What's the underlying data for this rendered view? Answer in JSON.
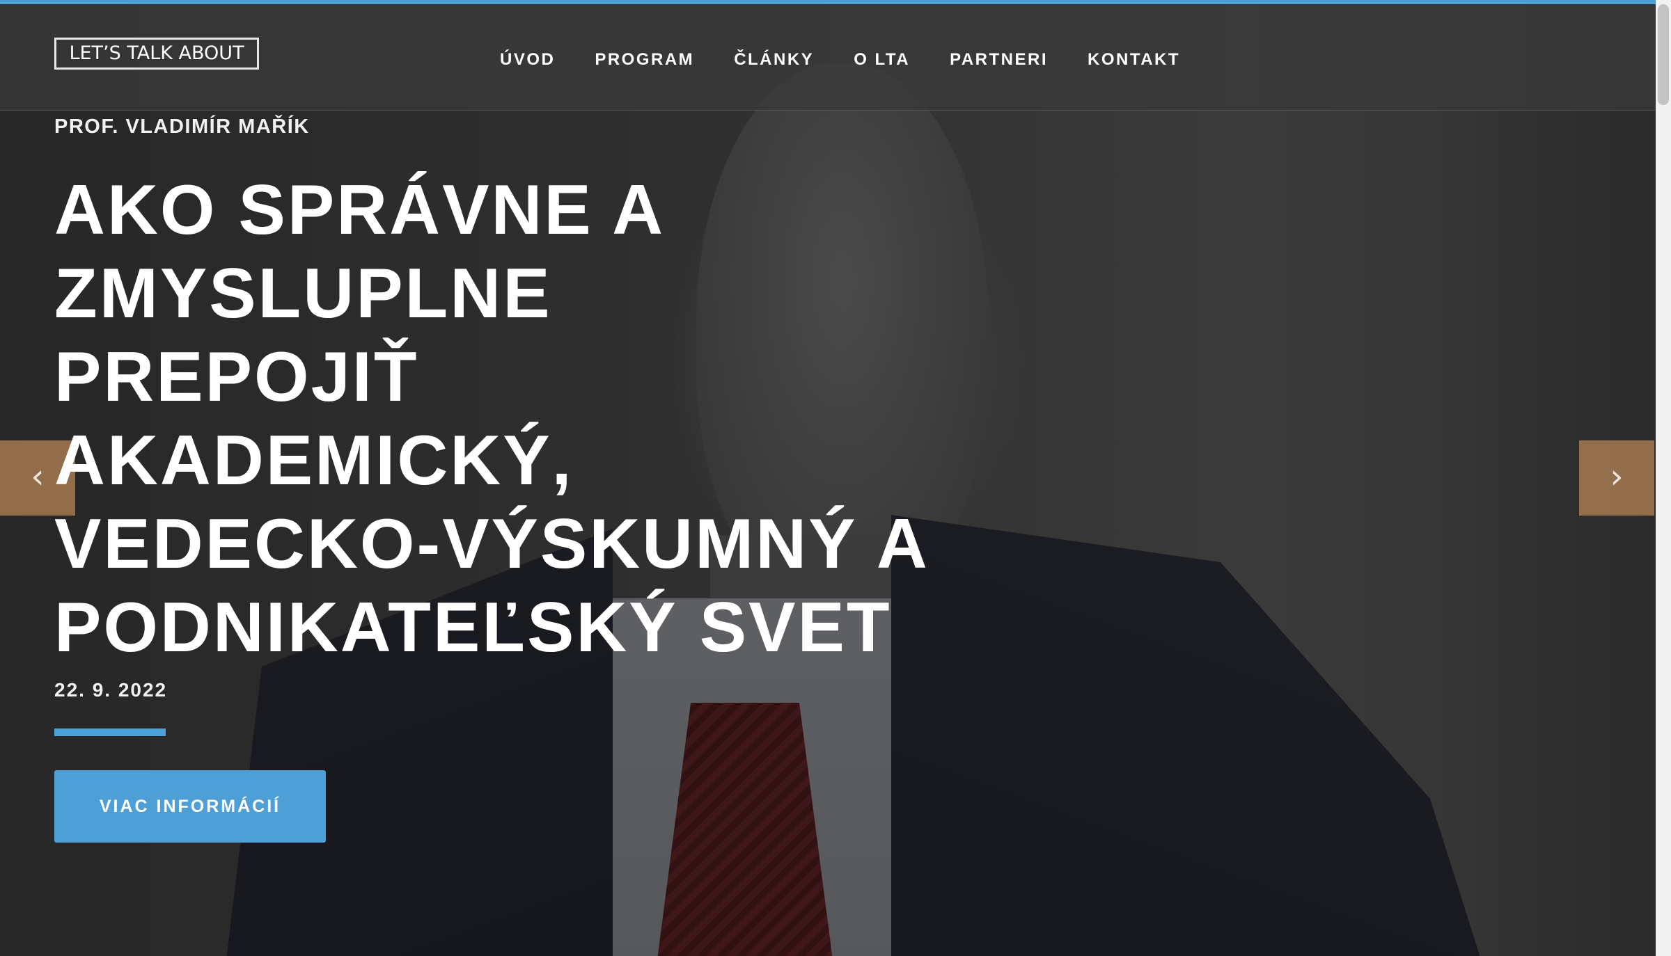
{
  "header": {
    "logo_text": "LET’S TALK ABOUT",
    "nav": [
      {
        "label": "ÚVOD"
      },
      {
        "label": "PROGRAM"
      },
      {
        "label": "ČLÁNKY"
      },
      {
        "label": "O LTA"
      },
      {
        "label": "PARTNERI"
      },
      {
        "label": "KONTAKT"
      }
    ]
  },
  "hero": {
    "speaker": "PROF. VLADIMÍR MAŘÍK",
    "title_lines": [
      "AKO SPRÁVNE A",
      "ZMYSLUPLNE",
      "PREPOJIŤ",
      "AKADEMICKÝ,",
      "VEDECKO-VÝSKUMNÝ A",
      "PODNIKATEĽSKÝ SVET"
    ],
    "date": "22. 9. 2022",
    "cta_label": "VIAC INFORMÁCIÍ",
    "prev_icon": "chevron-left-icon",
    "next_icon": "chevron-right-icon",
    "prev_glyph": "‹",
    "next_glyph": "›"
  },
  "colors": {
    "accent": "#4f9fd7",
    "arrow_bg": "#b08154"
  }
}
